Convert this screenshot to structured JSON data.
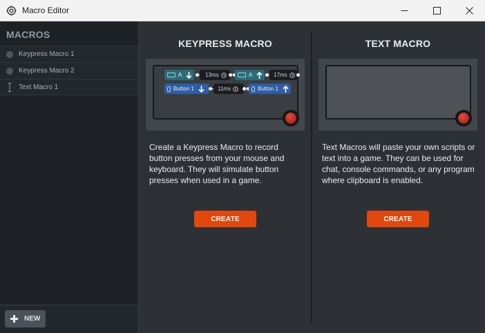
{
  "window": {
    "title": "Macro Editor"
  },
  "sidebar": {
    "heading": "MACROS",
    "items": [
      {
        "label": "Keypress Macro 1",
        "type": "keypress"
      },
      {
        "label": "Keypress Macro 2",
        "type": "keypress"
      },
      {
        "label": "Text Macro 1",
        "type": "text"
      }
    ],
    "new_label": "NEW"
  },
  "keypress_panel": {
    "title": "KEYPRESS MACRO",
    "description": "Create a Keypress Macro to record button presses from your mouse and keyboard. They will simulate button presses when used in a game.",
    "create_label": "CREATE",
    "preview": {
      "key1": "A",
      "delay1": "13ms",
      "key2": "A",
      "delay2": "17ms",
      "btn1": "Button 1",
      "delay3": "11ms",
      "btn2": "Button 1"
    }
  },
  "text_panel": {
    "title": "TEXT MACRO",
    "description": "Text Macros will paste your own scripts or text into a game. They can be used for chat, console commands, or any program where clipboard is enabled.",
    "create_label": "CREATE"
  },
  "colors": {
    "accent": "#e2470e",
    "teal_chip": "#2b6b78",
    "blue_chip": "#2e5ea6",
    "record": "#c62a1f"
  }
}
